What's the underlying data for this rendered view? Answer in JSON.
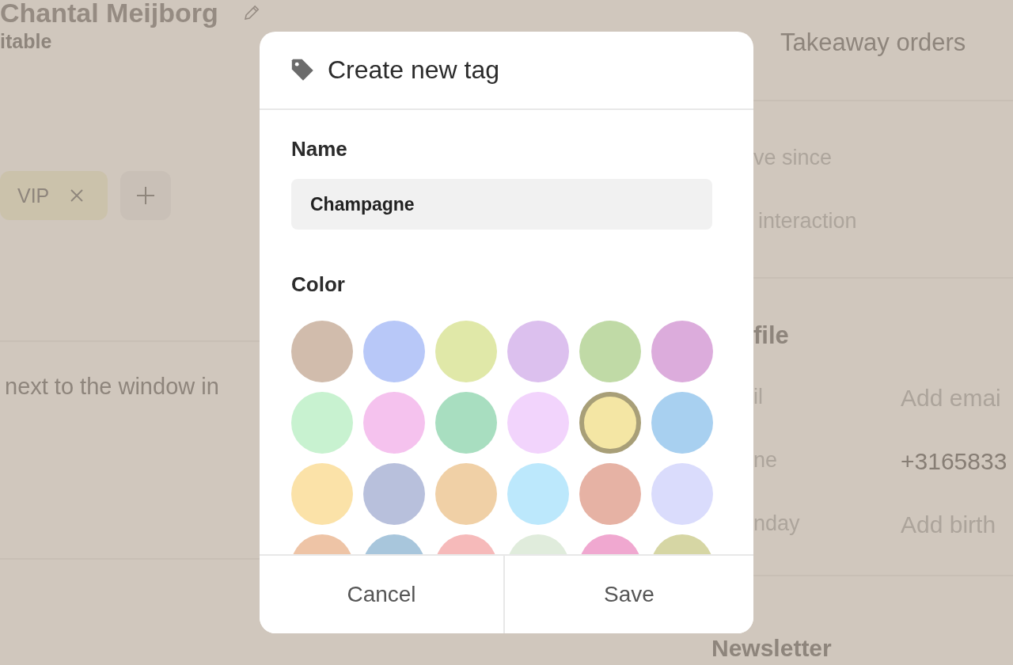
{
  "background": {
    "title": "Chantal Meijborg",
    "subtitle": "itable",
    "tags": [
      {
        "label": "VIP",
        "color": "#cbc2ab"
      }
    ],
    "note": "next to the window in",
    "right": {
      "heading": "Takeaway orders",
      "stats": [
        {
          "label": "ve since"
        },
        {
          "label": "interaction"
        }
      ],
      "section": "file",
      "fields": [
        {
          "label": "il",
          "value": "Add emai",
          "filled": false
        },
        {
          "label": "ne",
          "value": "+3165833",
          "filled": true
        },
        {
          "label": "nday",
          "value": "Add birth",
          "filled": false
        }
      ],
      "section2": "Newsletter"
    }
  },
  "dialog": {
    "title": "Create new tag",
    "name_label": "Name",
    "name_value": "Champagne",
    "color_label": "Color",
    "colors": [
      {
        "color": "#d1bcac",
        "selected": false
      },
      {
        "color": "#b8c8f8",
        "selected": false
      },
      {
        "color": "#e0e8a8",
        "selected": false
      },
      {
        "color": "#dcc0ee",
        "selected": false
      },
      {
        "color": "#c0daa6",
        "selected": false
      },
      {
        "color": "#dcacdc",
        "selected": false
      },
      {
        "color": "#c8f2d0",
        "selected": false
      },
      {
        "color": "#f5c2ee",
        "selected": false
      },
      {
        "color": "#a8dec0",
        "selected": false
      },
      {
        "color": "#f2d4fc",
        "selected": false
      },
      {
        "color": "#f4e6a4",
        "selected": true
      },
      {
        "color": "#a8d0f0",
        "selected": false
      },
      {
        "color": "#fbe2a8",
        "selected": false
      },
      {
        "color": "#b8c0dc",
        "selected": false
      },
      {
        "color": "#f0d0a6",
        "selected": false
      },
      {
        "color": "#bce8fc",
        "selected": false
      },
      {
        "color": "#e6b2a4",
        "selected": false
      },
      {
        "color": "#dadcfc",
        "selected": false
      },
      {
        "color": "#eec4a6",
        "selected": false
      },
      {
        "color": "#a8c6dc",
        "selected": false
      },
      {
        "color": "#f6baba",
        "selected": false
      },
      {
        "color": "#e0ecdc",
        "selected": false
      },
      {
        "color": "#f0a8d0",
        "selected": false
      },
      {
        "color": "#d6d6a4",
        "selected": false
      }
    ],
    "buttons": [
      "Cancel",
      "Save"
    ]
  }
}
